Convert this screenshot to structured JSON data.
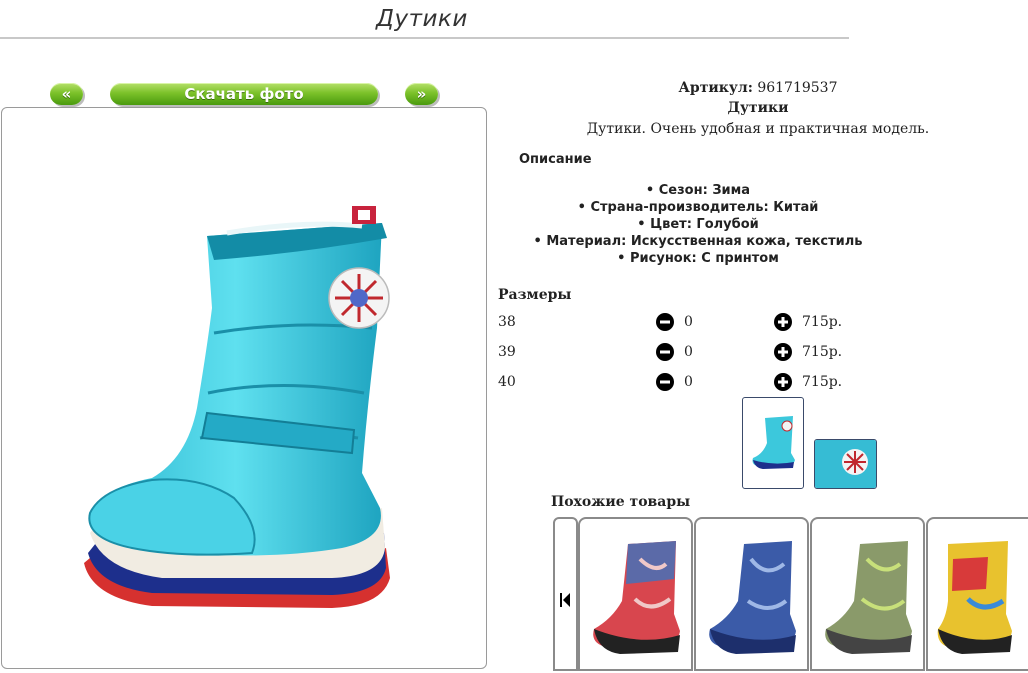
{
  "page": {
    "title": "Дутики"
  },
  "gallery": {
    "prev_label": "«",
    "download_label": "Скачать фото",
    "next_label": "»"
  },
  "product": {
    "article_label": "Артикул:",
    "article_value": "961719537",
    "name": "Дутики",
    "description": "Дутики. Очень удобная и практичная модель.",
    "description_heading": "Описание",
    "properties": [
      "Сезон: Зима",
      "Страна-производитель: Китай",
      "Цвет: Голубой",
      "Материал: Искусственная кожа, текстиль",
      "Рисунок: С принтом"
    ]
  },
  "sizes": {
    "heading": "Размеры",
    "rows": [
      {
        "size": "38",
        "qty": "0",
        "price": "715р."
      },
      {
        "size": "39",
        "qty": "0",
        "price": "715р."
      },
      {
        "size": "40",
        "qty": "0",
        "price": "715р."
      }
    ]
  },
  "similar": {
    "heading": "Похожие товары"
  },
  "colors": {
    "button_green": "#7cc22a",
    "boot_main": "#3cc8dc",
    "frame": "#9a9a9a"
  },
  "icons": [
    "minus-circle-icon",
    "plus-circle-icon",
    "skip-back-icon"
  ]
}
